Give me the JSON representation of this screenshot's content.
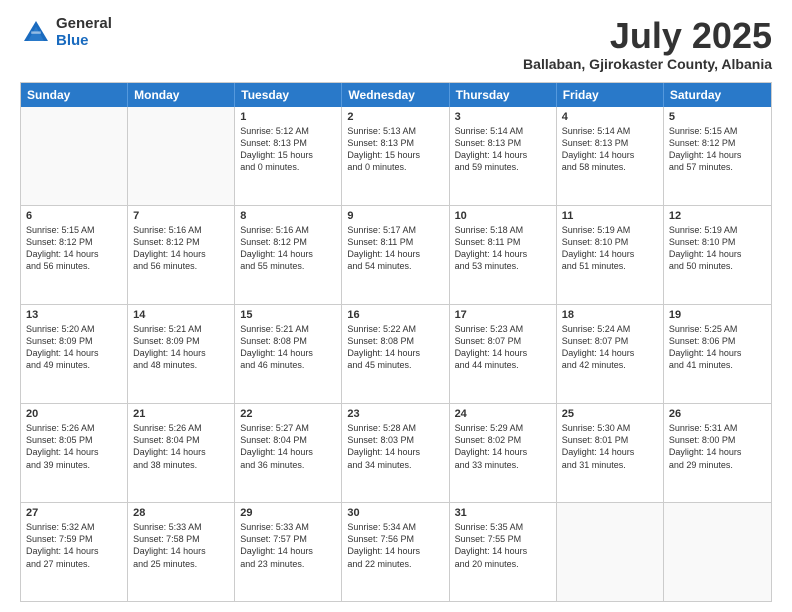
{
  "header": {
    "logo_general": "General",
    "logo_blue": "Blue",
    "month": "July 2025",
    "location": "Ballaban, Gjirokaster County, Albania"
  },
  "days_of_week": [
    "Sunday",
    "Monday",
    "Tuesday",
    "Wednesday",
    "Thursday",
    "Friday",
    "Saturday"
  ],
  "weeks": [
    [
      {
        "day": "",
        "info": ""
      },
      {
        "day": "",
        "info": ""
      },
      {
        "day": "1",
        "info": "Sunrise: 5:12 AM\nSunset: 8:13 PM\nDaylight: 15 hours\nand 0 minutes."
      },
      {
        "day": "2",
        "info": "Sunrise: 5:13 AM\nSunset: 8:13 PM\nDaylight: 15 hours\nand 0 minutes."
      },
      {
        "day": "3",
        "info": "Sunrise: 5:14 AM\nSunset: 8:13 PM\nDaylight: 14 hours\nand 59 minutes."
      },
      {
        "day": "4",
        "info": "Sunrise: 5:14 AM\nSunset: 8:13 PM\nDaylight: 14 hours\nand 58 minutes."
      },
      {
        "day": "5",
        "info": "Sunrise: 5:15 AM\nSunset: 8:12 PM\nDaylight: 14 hours\nand 57 minutes."
      }
    ],
    [
      {
        "day": "6",
        "info": "Sunrise: 5:15 AM\nSunset: 8:12 PM\nDaylight: 14 hours\nand 56 minutes."
      },
      {
        "day": "7",
        "info": "Sunrise: 5:16 AM\nSunset: 8:12 PM\nDaylight: 14 hours\nand 56 minutes."
      },
      {
        "day": "8",
        "info": "Sunrise: 5:16 AM\nSunset: 8:12 PM\nDaylight: 14 hours\nand 55 minutes."
      },
      {
        "day": "9",
        "info": "Sunrise: 5:17 AM\nSunset: 8:11 PM\nDaylight: 14 hours\nand 54 minutes."
      },
      {
        "day": "10",
        "info": "Sunrise: 5:18 AM\nSunset: 8:11 PM\nDaylight: 14 hours\nand 53 minutes."
      },
      {
        "day": "11",
        "info": "Sunrise: 5:19 AM\nSunset: 8:10 PM\nDaylight: 14 hours\nand 51 minutes."
      },
      {
        "day": "12",
        "info": "Sunrise: 5:19 AM\nSunset: 8:10 PM\nDaylight: 14 hours\nand 50 minutes."
      }
    ],
    [
      {
        "day": "13",
        "info": "Sunrise: 5:20 AM\nSunset: 8:09 PM\nDaylight: 14 hours\nand 49 minutes."
      },
      {
        "day": "14",
        "info": "Sunrise: 5:21 AM\nSunset: 8:09 PM\nDaylight: 14 hours\nand 48 minutes."
      },
      {
        "day": "15",
        "info": "Sunrise: 5:21 AM\nSunset: 8:08 PM\nDaylight: 14 hours\nand 46 minutes."
      },
      {
        "day": "16",
        "info": "Sunrise: 5:22 AM\nSunset: 8:08 PM\nDaylight: 14 hours\nand 45 minutes."
      },
      {
        "day": "17",
        "info": "Sunrise: 5:23 AM\nSunset: 8:07 PM\nDaylight: 14 hours\nand 44 minutes."
      },
      {
        "day": "18",
        "info": "Sunrise: 5:24 AM\nSunset: 8:07 PM\nDaylight: 14 hours\nand 42 minutes."
      },
      {
        "day": "19",
        "info": "Sunrise: 5:25 AM\nSunset: 8:06 PM\nDaylight: 14 hours\nand 41 minutes."
      }
    ],
    [
      {
        "day": "20",
        "info": "Sunrise: 5:26 AM\nSunset: 8:05 PM\nDaylight: 14 hours\nand 39 minutes."
      },
      {
        "day": "21",
        "info": "Sunrise: 5:26 AM\nSunset: 8:04 PM\nDaylight: 14 hours\nand 38 minutes."
      },
      {
        "day": "22",
        "info": "Sunrise: 5:27 AM\nSunset: 8:04 PM\nDaylight: 14 hours\nand 36 minutes."
      },
      {
        "day": "23",
        "info": "Sunrise: 5:28 AM\nSunset: 8:03 PM\nDaylight: 14 hours\nand 34 minutes."
      },
      {
        "day": "24",
        "info": "Sunrise: 5:29 AM\nSunset: 8:02 PM\nDaylight: 14 hours\nand 33 minutes."
      },
      {
        "day": "25",
        "info": "Sunrise: 5:30 AM\nSunset: 8:01 PM\nDaylight: 14 hours\nand 31 minutes."
      },
      {
        "day": "26",
        "info": "Sunrise: 5:31 AM\nSunset: 8:00 PM\nDaylight: 14 hours\nand 29 minutes."
      }
    ],
    [
      {
        "day": "27",
        "info": "Sunrise: 5:32 AM\nSunset: 7:59 PM\nDaylight: 14 hours\nand 27 minutes."
      },
      {
        "day": "28",
        "info": "Sunrise: 5:33 AM\nSunset: 7:58 PM\nDaylight: 14 hours\nand 25 minutes."
      },
      {
        "day": "29",
        "info": "Sunrise: 5:33 AM\nSunset: 7:57 PM\nDaylight: 14 hours\nand 23 minutes."
      },
      {
        "day": "30",
        "info": "Sunrise: 5:34 AM\nSunset: 7:56 PM\nDaylight: 14 hours\nand 22 minutes."
      },
      {
        "day": "31",
        "info": "Sunrise: 5:35 AM\nSunset: 7:55 PM\nDaylight: 14 hours\nand 20 minutes."
      },
      {
        "day": "",
        "info": ""
      },
      {
        "day": "",
        "info": ""
      }
    ]
  ]
}
